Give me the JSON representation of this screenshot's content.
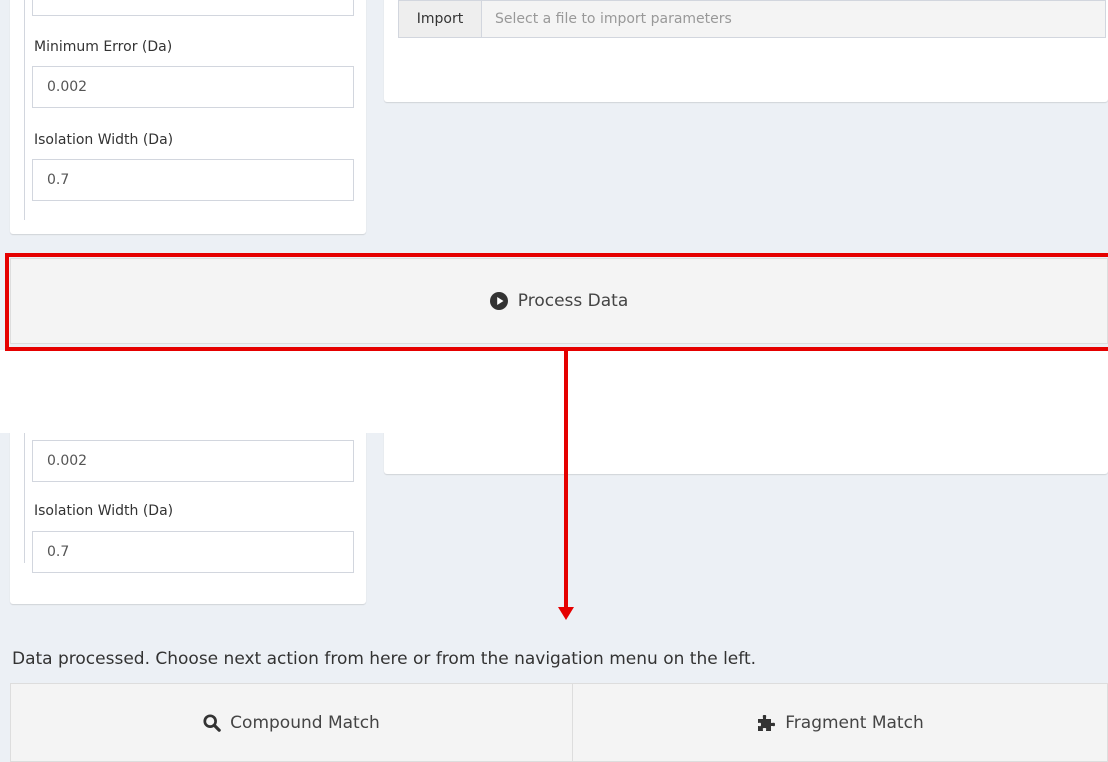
{
  "top_panel": {
    "import_label": "Import",
    "import_placeholder": "Select a file to import parameters",
    "min_error_label": "Minimum Error (Da)",
    "min_error_value": "0.002",
    "isolation_width_label": "Isolation Width (Da)",
    "isolation_width_value": "0.7"
  },
  "process_button": {
    "label": "Process Data",
    "icon": "play-circle-icon"
  },
  "bottom_panel": {
    "min_error_value": "0.002",
    "isolation_width_label": "Isolation Width (Da)",
    "isolation_width_value": "0.7",
    "status_message": "Data processed. Choose next action from here or from the navigation menu on the left.",
    "compound_match_label": "Compound Match",
    "compound_match_icon": "search-icon",
    "fragment_match_label": "Fragment Match",
    "fragment_match_icon": "puzzle-piece-icon"
  },
  "colors": {
    "highlight": "#e50000",
    "background": "#ecf0f5",
    "button_bg": "#f4f4f4"
  }
}
